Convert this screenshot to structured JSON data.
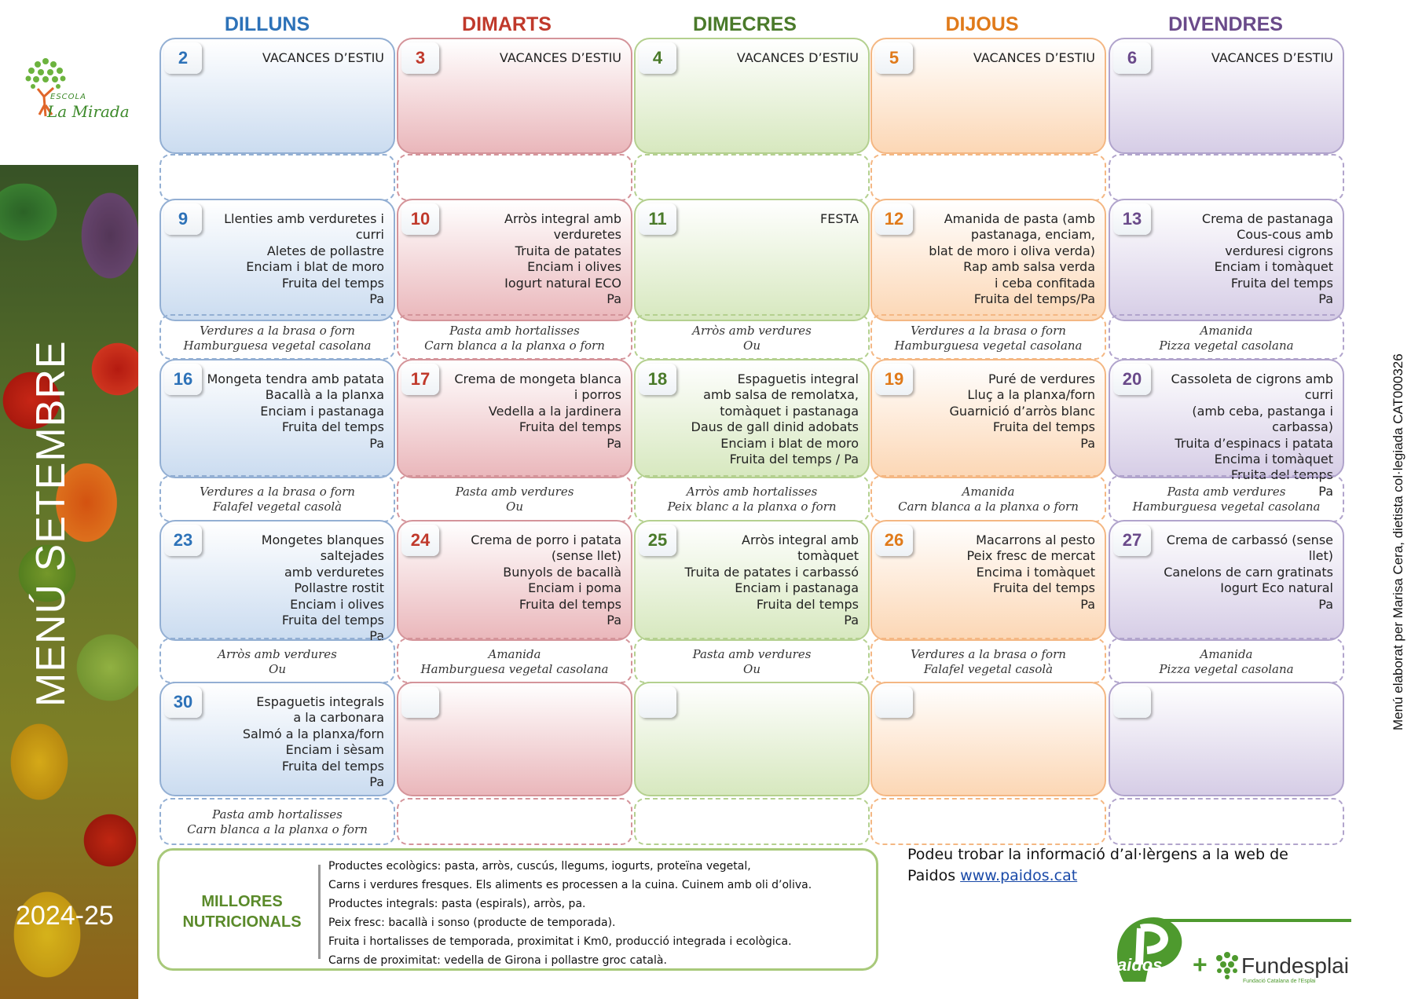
{
  "side": {
    "title": "MENÚ SETEMBRE",
    "year": "2024-25"
  },
  "school": {
    "escola": "ESCOLA",
    "name": "La Mirada"
  },
  "days": [
    "DILLUNS",
    "DIMARTS",
    "DIMECRES",
    "DIJOUS",
    "DIVENDRES"
  ],
  "colors": {
    "dilluns": "#2d72b8",
    "dimarts": "#c0392b",
    "dimecres": "#4a7a2a",
    "dijous": "#e07a1a",
    "divendres": "#6a4a8a"
  },
  "weeks": [
    {
      "lunch": [
        {
          "n": "2",
          "text": "VACANCES D’ESTIU"
        },
        {
          "n": "3",
          "text": "VACANCES D’ESTIU"
        },
        {
          "n": "4",
          "text": "VACANCES D’ESTIU"
        },
        {
          "n": "5",
          "text": "VACANCES D’ESTIU"
        },
        {
          "n": "6",
          "text": "VACANCES D’ESTIU"
        }
      ],
      "dinner": [
        "",
        "",
        "",
        "",
        ""
      ]
    },
    {
      "lunch": [
        {
          "n": "9",
          "text": "Llenties amb verduretes i curri\nAletes de pollastre\nEnciam i blat de moro\nFruita del temps\nPa"
        },
        {
          "n": "10",
          "text": "Arròs integral amb verduretes\nTruita de patates\nEnciam i olives\nIogurt natural ECO\nPa"
        },
        {
          "n": "11",
          "text": "FESTA"
        },
        {
          "n": "12",
          "text": "Amanida de pasta (amb\npastanaga, enciam,\nblat de moro i oliva verda)\nRap amb salsa verda\ni ceba confitada\nFruita del temps/Pa"
        },
        {
          "n": "13",
          "text": "Crema de pastanaga\nCous-cous amb\nverduresi cigrons\nEnciam i tomàquet\nFruita del temps\nPa"
        }
      ],
      "dinner": [
        "Verdures a la brasa o forn\nHamburguesa vegetal casolana",
        "Pasta amb hortalisses\nCarn blanca a la planxa o forn",
        "Arròs amb verdures\nOu",
        "Verdures a la brasa o forn\nHamburguesa vegetal casolana",
        "Amanida\nPizza vegetal casolana"
      ]
    },
    {
      "lunch": [
        {
          "n": "16",
          "text": "Mongeta tendra amb patata\nBacallà a la planxa\nEnciam i pastanaga\nFruita del temps\nPa"
        },
        {
          "n": "17",
          "text": "Crema de mongeta blanca\ni porros\nVedella a la jardinera\nFruita del temps\nPa"
        },
        {
          "n": "18",
          "text": "Espaguetis integral\namb salsa de remolatxa,\ntomàquet i pastanaga\nDaus de gall dinid adobats\nEnciam i blat de moro\nFruita del temps / Pa"
        },
        {
          "n": "19",
          "text": "Puré de verdures\nLluç a la planxa/forn\nGuarnició d’arròs blanc\nFruita del temps\nPa"
        },
        {
          "n": "20",
          "text": "Cassoleta de cigrons amb curri\n(amb ceba, pastanga i carbassa)\nTruita d’espinacs i patata\nEncima i tomàquet\nFruita del temps\nPa"
        }
      ],
      "dinner": [
        "Verdures a la brasa o forn\nFalafel vegetal casolà",
        "Pasta amb verdures\nOu",
        "Arròs amb hortalisses\nPeix blanc a la planxa o forn",
        "Amanida\nCarn blanca a la planxa o forn",
        "Pasta amb verdures\nHamburguesa vegetal casolana"
      ]
    },
    {
      "lunch": [
        {
          "n": "23",
          "text": "Mongetes blanques saltejades\namb verduretes\nPollastre rostit\nEnciam i olives\nFruita del temps\nPa"
        },
        {
          "n": "24",
          "text": "Crema de porro i patata\n(sense llet)\nBunyols de bacallà\nEnciam i poma\nFruita del temps\nPa"
        },
        {
          "n": "25",
          "text": "Arròs integral amb tomàquet\nTruita de patates i carbassó\nEnciam i pastanaga\nFruita del temps\nPa"
        },
        {
          "n": "26",
          "text": "Macarrons al pesto\nPeix fresc de mercat\nEncima i tomàquet\nFruita del temps\nPa"
        },
        {
          "n": "27",
          "text": "Crema de carbassó (sense llet)\nCanelons de carn gratinats\nIogurt Eco natural\nPa"
        }
      ],
      "dinner": [
        "Arròs amb verdures\nOu",
        "Amanida\nHamburguesa vegetal casolana",
        "Pasta amb verdures\nOu",
        "Verdures a la brasa o forn\nFalafel vegetal casolà",
        "Amanida\nPizza vegetal casolana"
      ]
    },
    {
      "lunch": [
        {
          "n": "30",
          "text": "Espaguetis integrals\na la carbonara\nSalmó a la planxa/forn\nEnciam i sèsam\nFruita del temps\nPa"
        },
        {
          "n": "",
          "text": ""
        },
        {
          "n": "",
          "text": ""
        },
        {
          "n": "",
          "text": ""
        },
        {
          "n": "",
          "text": ""
        }
      ],
      "dinner": [
        "Pasta amb hortalisses\nCarn blanca a la planxa o forn",
        "",
        "",
        "",
        ""
      ]
    }
  ],
  "millores": {
    "title": "MILLORES\nNUTRICIONALS",
    "items": [
      "Productes ecològics: pasta, arròs, cuscús,  llegums, iogurts, proteïna vegetal,",
      "Carns i verdures fresques. Els aliments es processen a la cuina. Cuinem amb oli d’oliva.",
      "Productes integrals: pasta (espirals), arròs, pa.",
      "Peix fresc: bacallà i sonso (producte de temporada).",
      "Fruita i hortalisses de temporada, proximitat i Km0,  producció integrada i ecològica.",
      "Carns de proximitat: vedella de Girona i pollastre groc català."
    ]
  },
  "allergens": {
    "line1": "Podeu trobar la informació d’al·lèrgens a la web de",
    "line2": "Paidos ",
    "link": "www.paidos.cat"
  },
  "credit": "Menú elaborat per Marisa Cera, dietista col·legiada CAT000326",
  "logos": {
    "paidos": "aidos",
    "plus": "+",
    "fundesplai": "Fundesplai",
    "fundesplai_sub": "Fundació Catalana de l’Esplai"
  }
}
